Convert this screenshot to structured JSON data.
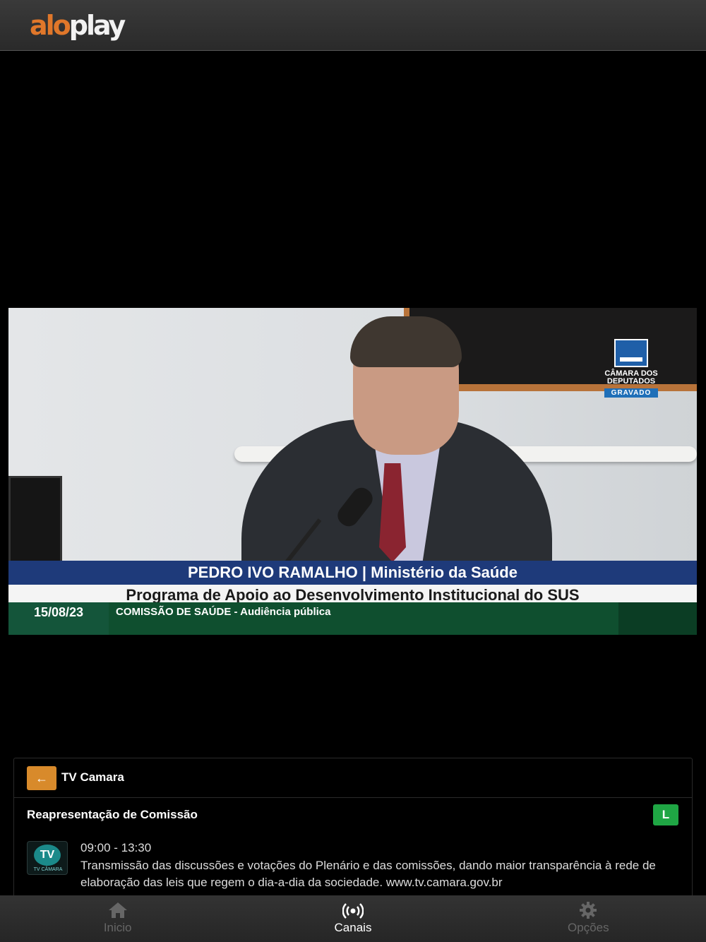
{
  "header": {
    "logo_alo": "alo",
    "logo_play": "play"
  },
  "video": {
    "watermark_line1": "CÂMARA DOS",
    "watermark_line2": "DEPUTADOS",
    "watermark_badge": "GRAVADO",
    "lower_third_name": "PEDRO IVO RAMALHO | Ministério da Saúde",
    "lower_third_subject": "Programa de Apoio ao Desenvolvimento Institucional do SUS",
    "date": "15/08/23",
    "event": "COMISSÃO DE SAÚDE - Audiência pública"
  },
  "panel": {
    "back_icon": "arrow-left-icon",
    "channel_name": "TV Camara",
    "program_title": "Reapresentação de Comissão",
    "rating": "L",
    "logo_caption": "TV CÂMARA",
    "time_range": "09:00 - 13:30",
    "description": "Transmissão das discussões e votações do Plenário e das comissões, dando maior transparência à rede de elaboração das leis que regem o dia-a-dia da sociedade. www.tv.camara.gov.br",
    "accent_color": "#1f7bd6"
  },
  "nav": {
    "items": [
      {
        "label": "Inicio",
        "icon": "home-icon",
        "active": false
      },
      {
        "label": "Canais",
        "icon": "broadcast-icon",
        "active": true
      },
      {
        "label": "Opções",
        "icon": "gear-icon",
        "active": false
      }
    ]
  }
}
